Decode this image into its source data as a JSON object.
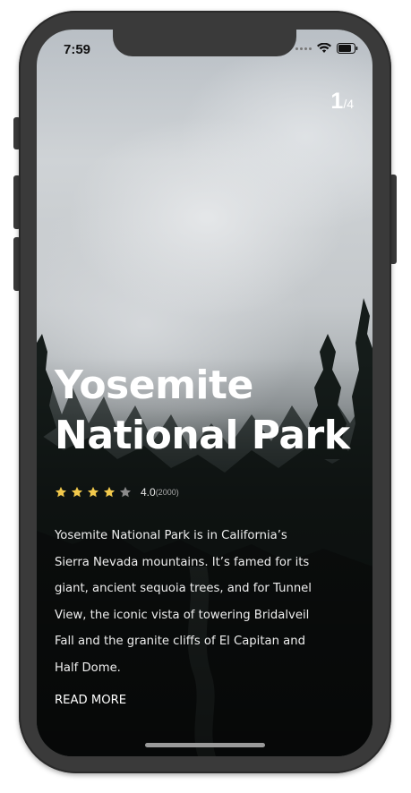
{
  "status_bar": {
    "time": "7:59"
  },
  "pager": {
    "current": "1",
    "separator": "/",
    "total": "4"
  },
  "place": {
    "title": "Yosemite National Park",
    "rating": {
      "stars_filled": 4,
      "stars_total": 5,
      "value": "4.0",
      "count": "(2000)"
    },
    "description": "Yosemite National Park is in California’s Sierra Nevada mountains. It’s famed for its giant, ancient sequoia trees, and for Tunnel View, the iconic vista of towering Bridalveil Fall and the granite cliffs of El Capitan and Half Dome.",
    "read_more_label": "READ MORE"
  },
  "colors": {
    "star_filled": "#f2c94c",
    "star_empty": "#8a8a8a",
    "text": "#ffffff",
    "device_frame": "#3a3a3a"
  },
  "icons": [
    "cellular-signal-icon",
    "wifi-icon",
    "battery-icon",
    "star-icon"
  ]
}
